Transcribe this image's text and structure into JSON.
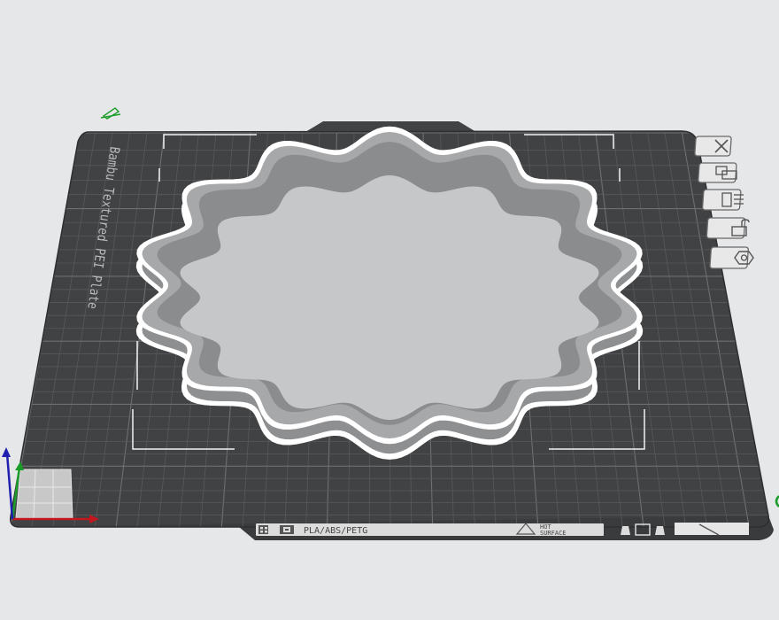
{
  "plate": {
    "name": "Bambu Textured PEI Plate",
    "filament_label": "PLA/ABS/PETG",
    "hot_label": "HOT",
    "surface_label": "SURFACE"
  },
  "toolbar": {
    "buttons": [
      {
        "name": "close-icon"
      },
      {
        "name": "arrange-icon"
      },
      {
        "name": "plate-settings-icon"
      },
      {
        "name": "lock-icon"
      },
      {
        "name": "settings-hex-icon"
      }
    ]
  },
  "colors": {
    "background": "#e6e7e8",
    "plate": "#414244",
    "grid": "#5c5d60",
    "model": "#8e8f91",
    "model_inner": "#c6c7c8",
    "outline": "#ffffff",
    "axis_x": "#c0181e",
    "axis_y": "#1a9c2a",
    "axis_z": "#1f1fb0"
  }
}
